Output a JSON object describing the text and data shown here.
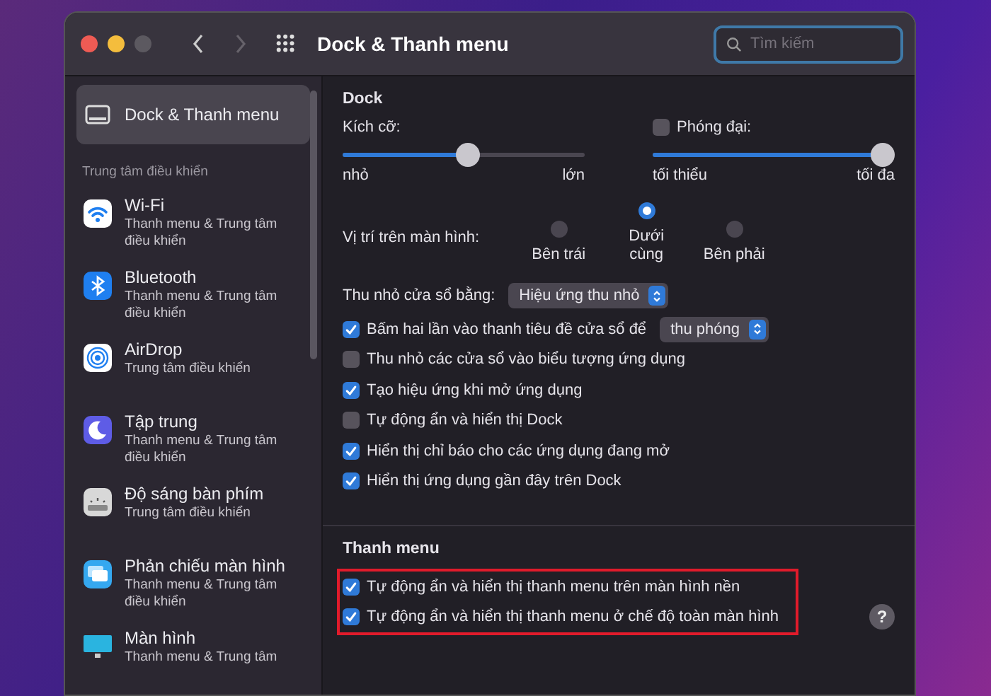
{
  "window": {
    "title": "Dock & Thanh menu",
    "search": {
      "placeholder": "Tìm kiếm"
    },
    "forward_disabled": true
  },
  "sidebar": {
    "items": [
      {
        "kind": "dock",
        "label": "Dock & Thanh menu",
        "selected": true
      }
    ],
    "section": "Trung tâm điều khiển",
    "section_items": [
      {
        "kind": "wifi",
        "label": "Wi-Fi",
        "subtitle": "Thanh menu & Trung tâm điều khiển",
        "selected": false
      },
      {
        "kind": "bluetooth",
        "label": "Bluetooth",
        "subtitle": "Thanh menu & Trung tâm điều khiển",
        "selected": false
      },
      {
        "kind": "airdrop",
        "label": "AirDrop",
        "subtitle": "Trung tâm điều khiển",
        "selected": false
      },
      {
        "kind": "focus",
        "label": "Tập trung",
        "subtitle": "Thanh menu & Trung tâm điều khiển",
        "selected": false
      },
      {
        "kind": "keyboard",
        "label": "Độ sáng bàn phím",
        "subtitle": "Trung tâm điều khiển",
        "selected": false
      },
      {
        "kind": "mirroring",
        "label": "Phản chiếu màn hình",
        "subtitle": "Thanh menu & Trung tâm điều khiển",
        "selected": false
      },
      {
        "kind": "display",
        "label": "Màn hình",
        "subtitle": "Thanh menu & Trung tâm",
        "selected": false
      }
    ]
  },
  "dock": {
    "title": "Dock",
    "size": {
      "label": "Kích cỡ:",
      "level": 0.52,
      "min_label": "nhỏ",
      "max_label": "lớn"
    },
    "magnification": {
      "label": "Phóng đại:",
      "checked": false,
      "level": 1.0,
      "min_label": "tối thiểu",
      "max_label": "tối đa"
    },
    "position": {
      "label": "Vị trí trên màn hình:",
      "options": [
        {
          "label": "Bên trái",
          "selected": false
        },
        {
          "label": "Dưới cùng",
          "selected": true
        },
        {
          "label": "Bên phải",
          "selected": false
        }
      ]
    },
    "minimize": {
      "label": "Thu nhỏ cửa sổ bằng:",
      "value": "Hiệu ứng thu nhỏ"
    },
    "options": [
      {
        "label": "Bấm hai lần vào thanh tiêu đề cửa sổ để",
        "checked": true,
        "select": "thu phóng"
      },
      {
        "label": "Thu nhỏ các cửa sổ vào biểu tượng ứng dụng",
        "checked": false
      },
      {
        "label": "Tạo hiệu ứng khi mở ứng dụng",
        "checked": true
      },
      {
        "label": "Tự động ẩn và hiển thị Dock",
        "checked": false
      },
      {
        "label": "Hiển thị chỉ báo cho các ứng dụng đang mở",
        "checked": true
      },
      {
        "label": "Hiển thị ứng dụng gần đây trên Dock",
        "checked": true
      }
    ]
  },
  "menu_bar": {
    "title": "Thanh menu",
    "highlighted": true,
    "options": [
      {
        "label": "Tự động ẩn và hiển thị thanh menu trên màn hình nền",
        "checked": true
      },
      {
        "label": "Tự động ẩn và hiển thị thanh menu ở chế độ toàn màn hình",
        "checked": true
      }
    ]
  },
  "help": "?"
}
